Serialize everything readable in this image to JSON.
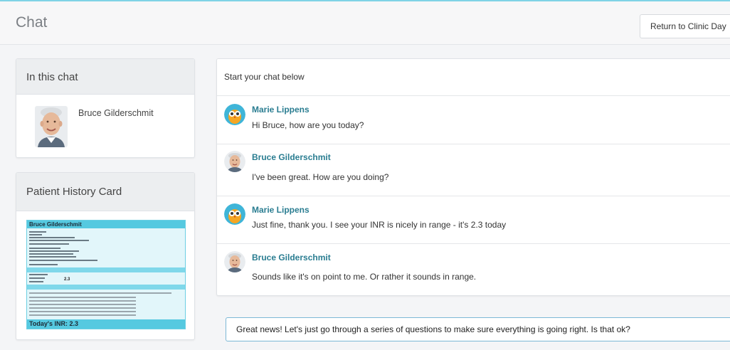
{
  "header": {
    "title": "Chat",
    "return_label": "Return to Clinic Day"
  },
  "participants_panel": {
    "title": "In this chat",
    "name": "Bruce Gilderschmit"
  },
  "history_panel": {
    "title": "Patient History Card",
    "card": {
      "patient_name": "Bruce Gilderschmit",
      "inr_value": "2.3",
      "footer": "Today's INR: 2.3"
    }
  },
  "chat": {
    "intro": "Start your chat below",
    "messages": [
      {
        "sender": "Marie Lippens",
        "text": "Hi Bruce, how are you today?"
      },
      {
        "sender": "Bruce Gilderschmit",
        "text": "I've been great. How are you doing?"
      },
      {
        "sender": "Marie Lippens",
        "text": "Just fine, thank you. I see your INR is nicely in range - it's 2.3 today"
      },
      {
        "sender": "Bruce Gilderschmit",
        "text": "Sounds like it's on point to me. Or rather it sounds in range."
      }
    ]
  },
  "composer": {
    "value": "Great news! Let's just go through a series of questions to make sure everything is going right. Is that ok?"
  },
  "icons": {
    "clinician_avatar": "owl-avatar-icon",
    "patient_avatar": "patient-photo-icon"
  },
  "colors": {
    "accent": "#2a7d91",
    "card_header": "#55c9e0",
    "top_line": "#7fd3e6"
  }
}
